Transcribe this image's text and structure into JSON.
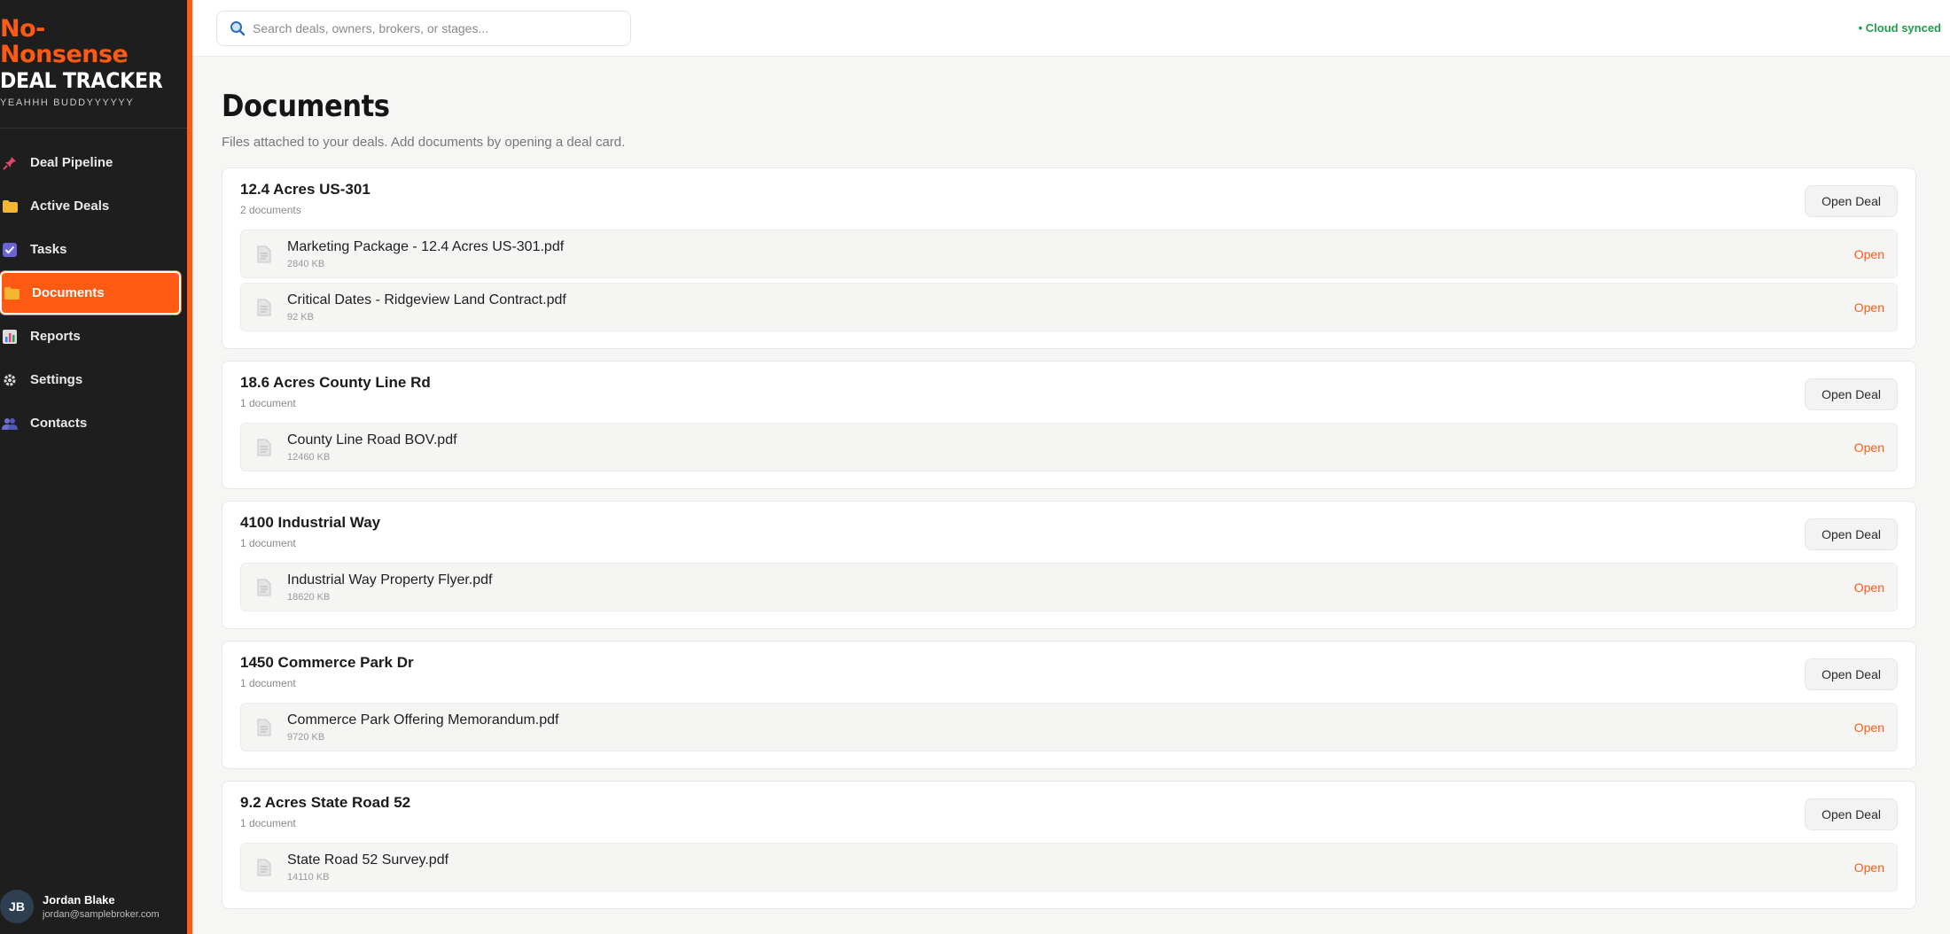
{
  "brand": {
    "line1": "No-",
    "line2": "Nonsense",
    "line3": "DEAL TRACKER",
    "tagline": "YEAHHH BUDDYYYYYY"
  },
  "nav": [
    {
      "label": "Deal Pipeline",
      "icon": "pin-icon"
    },
    {
      "label": "Active Deals",
      "icon": "folder-icon"
    },
    {
      "label": "Tasks",
      "icon": "checkbox-icon"
    },
    {
      "label": "Documents",
      "icon": "folder-icon",
      "active": true
    },
    {
      "label": "Reports",
      "icon": "bar-chart-icon"
    },
    {
      "label": "Settings",
      "icon": "gear-icon"
    },
    {
      "label": "Contacts",
      "icon": "people-icon"
    }
  ],
  "user": {
    "initials": "JB",
    "name": "Jordan Blake",
    "email": "jordan@samplebroker.com"
  },
  "search": {
    "placeholder": "Search deals, owners, brokers, or stages..."
  },
  "sync_status": "• Cloud synced",
  "page": {
    "title": "Documents",
    "subtitle": "Files attached to your deals. Add documents by opening a deal card."
  },
  "open_deal_label": "Open Deal",
  "open_label": "Open",
  "deals": [
    {
      "name": "12.4 Acres US-301",
      "count": "2 documents",
      "docs": [
        {
          "name": "Marketing Package - 12.4 Acres US-301.pdf",
          "size": "2840 KB"
        },
        {
          "name": "Critical Dates - Ridgeview Land Contract.pdf",
          "size": "92 KB"
        }
      ]
    },
    {
      "name": "18.6 Acres County Line Rd",
      "count": "1 document",
      "docs": [
        {
          "name": "County Line Road BOV.pdf",
          "size": "12460 KB"
        }
      ]
    },
    {
      "name": "4100 Industrial Way",
      "count": "1 document",
      "docs": [
        {
          "name": "Industrial Way Property Flyer.pdf",
          "size": "18620 KB"
        }
      ]
    },
    {
      "name": "1450 Commerce Park Dr",
      "count": "1 document",
      "docs": [
        {
          "name": "Commerce Park Offering Memorandum.pdf",
          "size": "9720 KB"
        }
      ]
    },
    {
      "name": "9.2 Acres State Road 52",
      "count": "1 document",
      "docs": [
        {
          "name": "State Road 52 Survey.pdf",
          "size": "14110 KB"
        }
      ]
    }
  ],
  "colors": {
    "accent": "#ff5a14",
    "sidebar": "#1e1e1e",
    "sync": "#1f9e4c"
  }
}
